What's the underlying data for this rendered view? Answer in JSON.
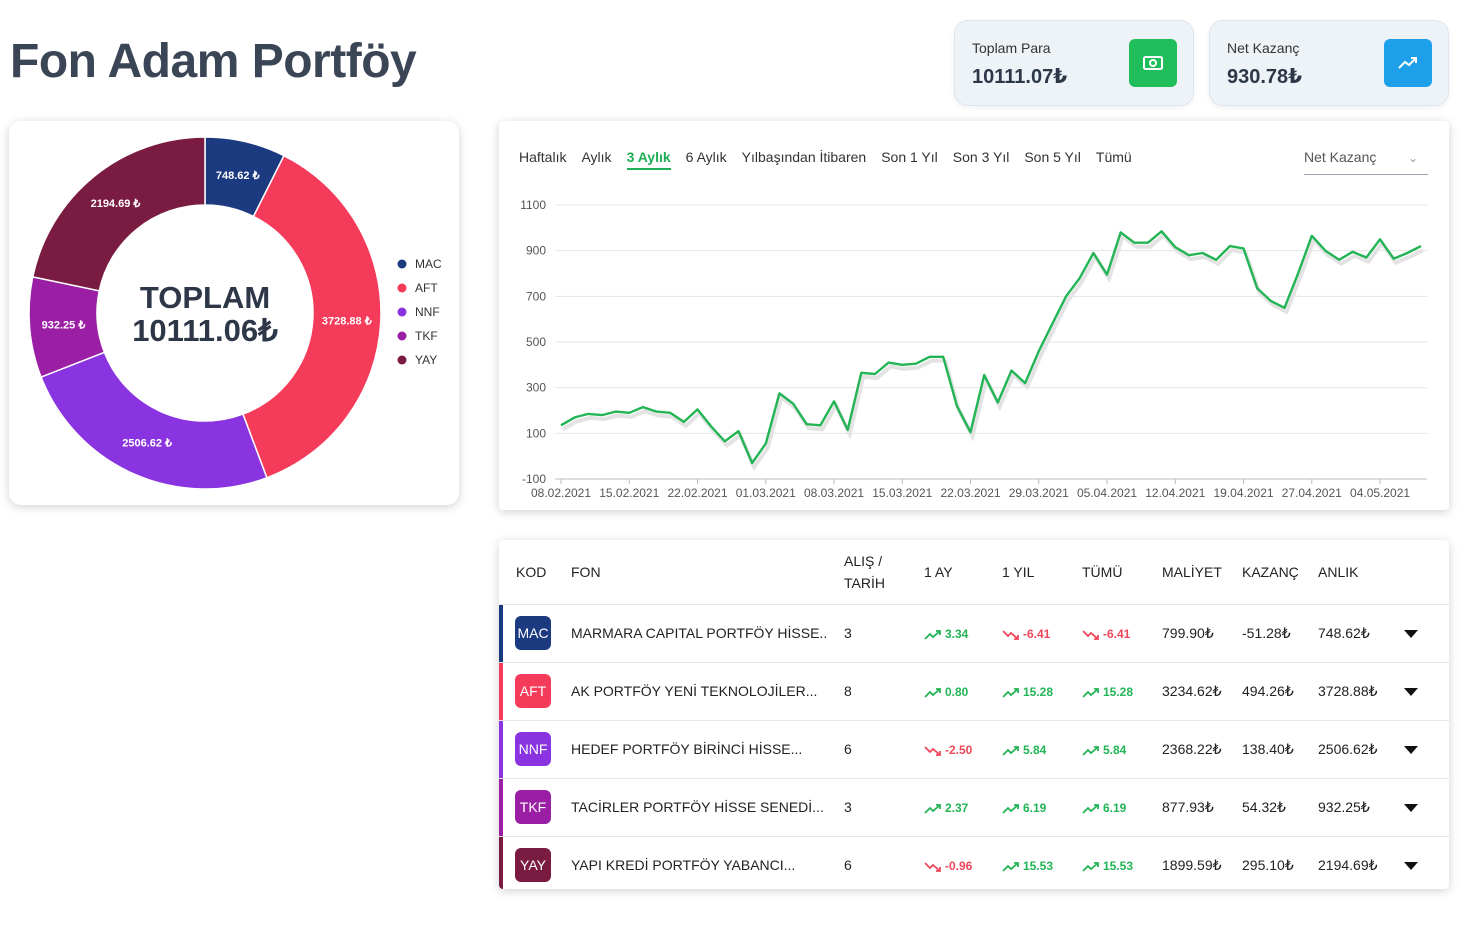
{
  "page": {
    "title": "Fon Adam Portföy"
  },
  "stats": [
    {
      "label": "Toplam Para",
      "value": "10111.07₺",
      "icon": "money-icon",
      "color": "#1fbe5b"
    },
    {
      "label": "Net Kazanç",
      "value": "930.78₺",
      "icon": "trending-up-icon",
      "color": "#1da0e9"
    }
  ],
  "donut": {
    "center_label": "TOPLAM",
    "center_value": "10111.06₺",
    "slices": [
      {
        "code": "MAC",
        "value": 748.62,
        "label": "748.62 ₺",
        "color": "#1b3a80"
      },
      {
        "code": "AFT",
        "value": 3728.88,
        "label": "3728.88 ₺",
        "color": "#f53b5a"
      },
      {
        "code": "NNF",
        "value": 2506.62,
        "label": "2506.62 ₺",
        "color": "#8a33e0"
      },
      {
        "code": "TKF",
        "value": 932.25,
        "label": "932.25 ₺",
        "color": "#9a1fa5"
      },
      {
        "code": "YAY",
        "value": 2194.69,
        "label": "2194.69 ₺",
        "color": "#7a1c42"
      }
    ]
  },
  "period_tabs": [
    "Haftalık",
    "Aylık",
    "3 Aylık",
    "6 Aylık",
    "Yılbaşından İtibaren",
    "Son 1 Yıl",
    "Son 3 Yıl",
    "Son 5 Yıl",
    "Tümü"
  ],
  "active_tab": "3 Aylık",
  "metric_select": {
    "value": "Net Kazanç"
  },
  "chart_data": {
    "type": "line",
    "title": "",
    "xlabel": "",
    "ylabel": "",
    "ylim": [
      -100,
      1100
    ],
    "yticks": [
      -100,
      100,
      300,
      500,
      700,
      900,
      1100
    ],
    "xticks": [
      "08.02.2021",
      "15.02.2021",
      "22.02.2021",
      "01.03.2021",
      "08.03.2021",
      "15.03.2021",
      "22.03.2021",
      "29.03.2021",
      "05.04.2021",
      "12.04.2021",
      "19.04.2021",
      "27.04.2021",
      "04.05.2021"
    ],
    "grid": true,
    "color": "#22b455",
    "series": [
      {
        "values": [
          135,
          170,
          185,
          180,
          195,
          190,
          215,
          195,
          190,
          150,
          205,
          130,
          65,
          110,
          -30,
          55,
          275,
          230,
          140,
          135,
          240,
          115,
          365,
          360,
          410,
          400,
          405,
          435,
          435,
          220,
          105,
          355,
          235,
          375,
          320,
          460,
          580,
          700,
          780,
          890,
          795,
          980,
          935,
          935,
          985,
          915,
          880,
          890,
          860,
          920,
          910,
          735,
          680,
          650,
          800,
          965,
          900,
          860,
          895,
          870,
          950,
          865,
          890,
          920
        ]
      }
    ]
  },
  "table": {
    "headers": {
      "code": "KOD",
      "fund": "FON",
      "buy_l1": "ALIŞ /",
      "buy_l2": "TARİH",
      "m1": "1 AY",
      "y1": "1 YIL",
      "all": "TÜMÜ",
      "cost": "MALİYET",
      "gain": "KAZANÇ",
      "current": "ANLIK"
    },
    "rows": [
      {
        "code": "MAC",
        "color": "#1b3a80",
        "fund": "MARMARA CAPITAL PORTFÖY HİSSE...",
        "buy": "3",
        "m1": {
          "value": "3.34",
          "dir": "up"
        },
        "y1": {
          "value": "-6.41",
          "dir": "down"
        },
        "all": {
          "value": "-6.41",
          "dir": "down"
        },
        "cost": "799.90₺",
        "gain": "-51.28₺",
        "current": "748.62₺"
      },
      {
        "code": "AFT",
        "color": "#f53b5a",
        "fund": "AK PORTFÖY YENİ TEKNOLOJİLER...",
        "buy": "8",
        "m1": {
          "value": "0.80",
          "dir": "up"
        },
        "y1": {
          "value": "15.28",
          "dir": "up"
        },
        "all": {
          "value": "15.28",
          "dir": "up"
        },
        "cost": "3234.62₺",
        "gain": "494.26₺",
        "current": "3728.88₺"
      },
      {
        "code": "NNF",
        "color": "#8a33e0",
        "fund": "HEDEF PORTFÖY BİRİNCİ HİSSE...",
        "buy": "6",
        "m1": {
          "value": "-2.50",
          "dir": "down"
        },
        "y1": {
          "value": "5.84",
          "dir": "up"
        },
        "all": {
          "value": "5.84",
          "dir": "up"
        },
        "cost": "2368.22₺",
        "gain": "138.40₺",
        "current": "2506.62₺"
      },
      {
        "code": "TKF",
        "color": "#9a1fa5",
        "fund": "TACİRLER PORTFÖY HİSSE SENEDİ...",
        "buy": "3",
        "m1": {
          "value": "2.37",
          "dir": "up"
        },
        "y1": {
          "value": "6.19",
          "dir": "up"
        },
        "all": {
          "value": "6.19",
          "dir": "up"
        },
        "cost": "877.93₺",
        "gain": "54.32₺",
        "current": "932.25₺"
      },
      {
        "code": "YAY",
        "color": "#7a1c42",
        "fund": "YAPI KREDİ PORTFÖY YABANCI...",
        "buy": "6",
        "m1": {
          "value": "-0.96",
          "dir": "down"
        },
        "y1": {
          "value": "15.53",
          "dir": "up"
        },
        "all": {
          "value": "15.53",
          "dir": "up"
        },
        "cost": "1899.59₺",
        "gain": "295.10₺",
        "current": "2194.69₺"
      }
    ]
  }
}
